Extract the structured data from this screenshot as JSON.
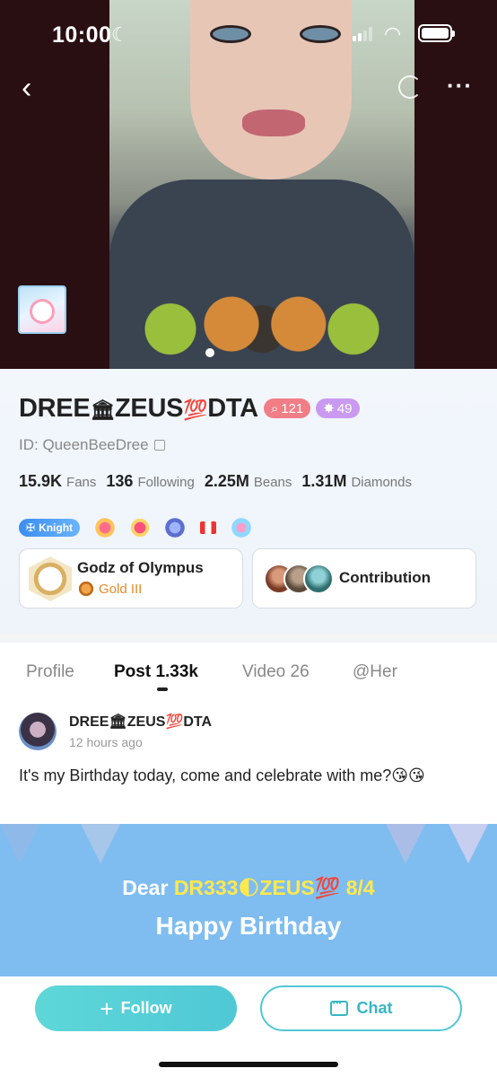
{
  "status_bar": {
    "time": "10:00"
  },
  "profile": {
    "name": "DREE",
    "name_emoji_1": "🏛",
    "name_mid": "ZEUS",
    "name_emoji_2": "💯",
    "name_end": "DTA",
    "level_badge": "121",
    "vip_badge": "49",
    "id_label": "ID: QueenBeeDree",
    "stats": [
      {
        "value": "15.9K",
        "label": "Fans"
      },
      {
        "value": "136",
        "label": "Following"
      },
      {
        "value": "2.25M",
        "label": "Beans"
      },
      {
        "value": "1.31M",
        "label": "Diamonds"
      }
    ],
    "knight_badge": "Knight",
    "family": {
      "name": "Godz of Olympus",
      "rank": "Gold III"
    },
    "contribution_label": "Contribution"
  },
  "tabs": [
    {
      "label": "Profile"
    },
    {
      "label": "Post 1.33k"
    },
    {
      "label": "Video 26"
    },
    {
      "label": "@Her"
    }
  ],
  "post": {
    "author": "DREE🏛ZEUS💯DTA",
    "time": "12 hours ago",
    "text": "It's my Birthday today, come and celebrate with me?😘😘",
    "image_line1_prefix": "Dear ",
    "image_line1_highlight": "DR333🌓ZEUS💯 8/4",
    "image_line2": "Happy Birthday"
  },
  "actions": {
    "follow_label": "Follow",
    "chat_label": "Chat"
  },
  "colors": {
    "accent": "#4fc8d6",
    "level_badge": "#f17d86",
    "vip_badge": "#c99af0",
    "rank": "#e28b2a"
  }
}
